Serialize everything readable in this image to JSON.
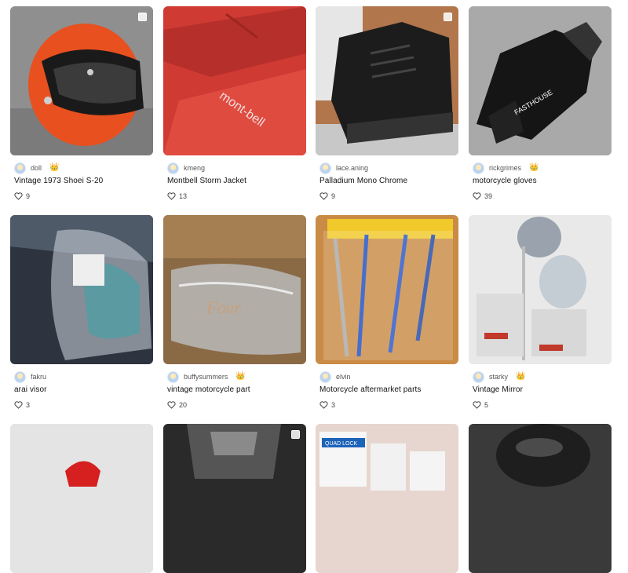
{
  "listings": [
    {
      "seller": "doll",
      "badge": true,
      "title": "Vintage 1973 Shoei S-20",
      "likes": "9",
      "selectable": true
    },
    {
      "seller": "kmeng",
      "badge": false,
      "title": "Montbell Storm Jacket",
      "likes": "13",
      "selectable": false,
      "image_text": "mont-bell"
    },
    {
      "seller": "lace.aning",
      "badge": false,
      "title": "Palladium Mono Chrome",
      "likes": "9",
      "selectable": true
    },
    {
      "seller": "rickgrimes",
      "badge": true,
      "title": "motorcycle gloves",
      "likes": "39",
      "selectable": false,
      "image_text": "FASTHOUSE"
    },
    {
      "seller": "fakru",
      "badge": false,
      "title": "arai visor",
      "likes": "3",
      "selectable": false
    },
    {
      "seller": "buffysummers",
      "badge": true,
      "title": "vintage motorcycle part",
      "likes": "20",
      "selectable": false,
      "image_text": "Four"
    },
    {
      "seller": "elvin",
      "badge": false,
      "title": "Motorcycle aftermarket parts",
      "likes": "3",
      "selectable": false
    },
    {
      "seller": "starky",
      "badge": true,
      "title": "Vintage Mirror",
      "likes": "5",
      "selectable": false
    },
    {
      "seller": "",
      "badge": false,
      "title": "",
      "likes": "",
      "selectable": false
    },
    {
      "seller": "",
      "badge": false,
      "title": "",
      "likes": "",
      "selectable": true
    },
    {
      "seller": "",
      "badge": false,
      "title": "",
      "likes": "",
      "selectable": false,
      "image_text": "QUAD LOCK"
    },
    {
      "seller": "",
      "badge": false,
      "title": "",
      "likes": "",
      "selectable": false
    }
  ],
  "icons": {
    "heart": "heart-outline-icon",
    "badge": "crown-badge-icon"
  },
  "colors": {
    "helmet": "#e8501f",
    "jacket": "#d93a32",
    "text": "#111111",
    "muted": "#555555"
  }
}
